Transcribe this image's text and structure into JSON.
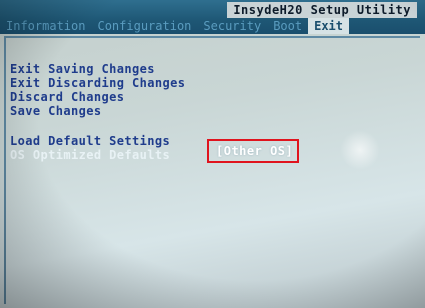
{
  "header": {
    "title": "InsydeH20 Setup Utility",
    "tabs": [
      {
        "label": "Information",
        "active": false
      },
      {
        "label": "Configuration",
        "active": false
      },
      {
        "label": "Security",
        "active": false
      },
      {
        "label": "Boot",
        "active": false
      },
      {
        "label": "Exit",
        "active": true
      }
    ]
  },
  "menu": {
    "items": [
      "Exit Saving Changes",
      "Exit Discarding Changes",
      "Discard Changes",
      "Save Changes",
      "Load Default Settings",
      "OS Optimized Defaults"
    ],
    "selected_value": "[Other OS]"
  },
  "colors": {
    "menu_text": "#1f3c8c",
    "header_bar": "#1e5775",
    "highlight_border": "#e0141e"
  }
}
